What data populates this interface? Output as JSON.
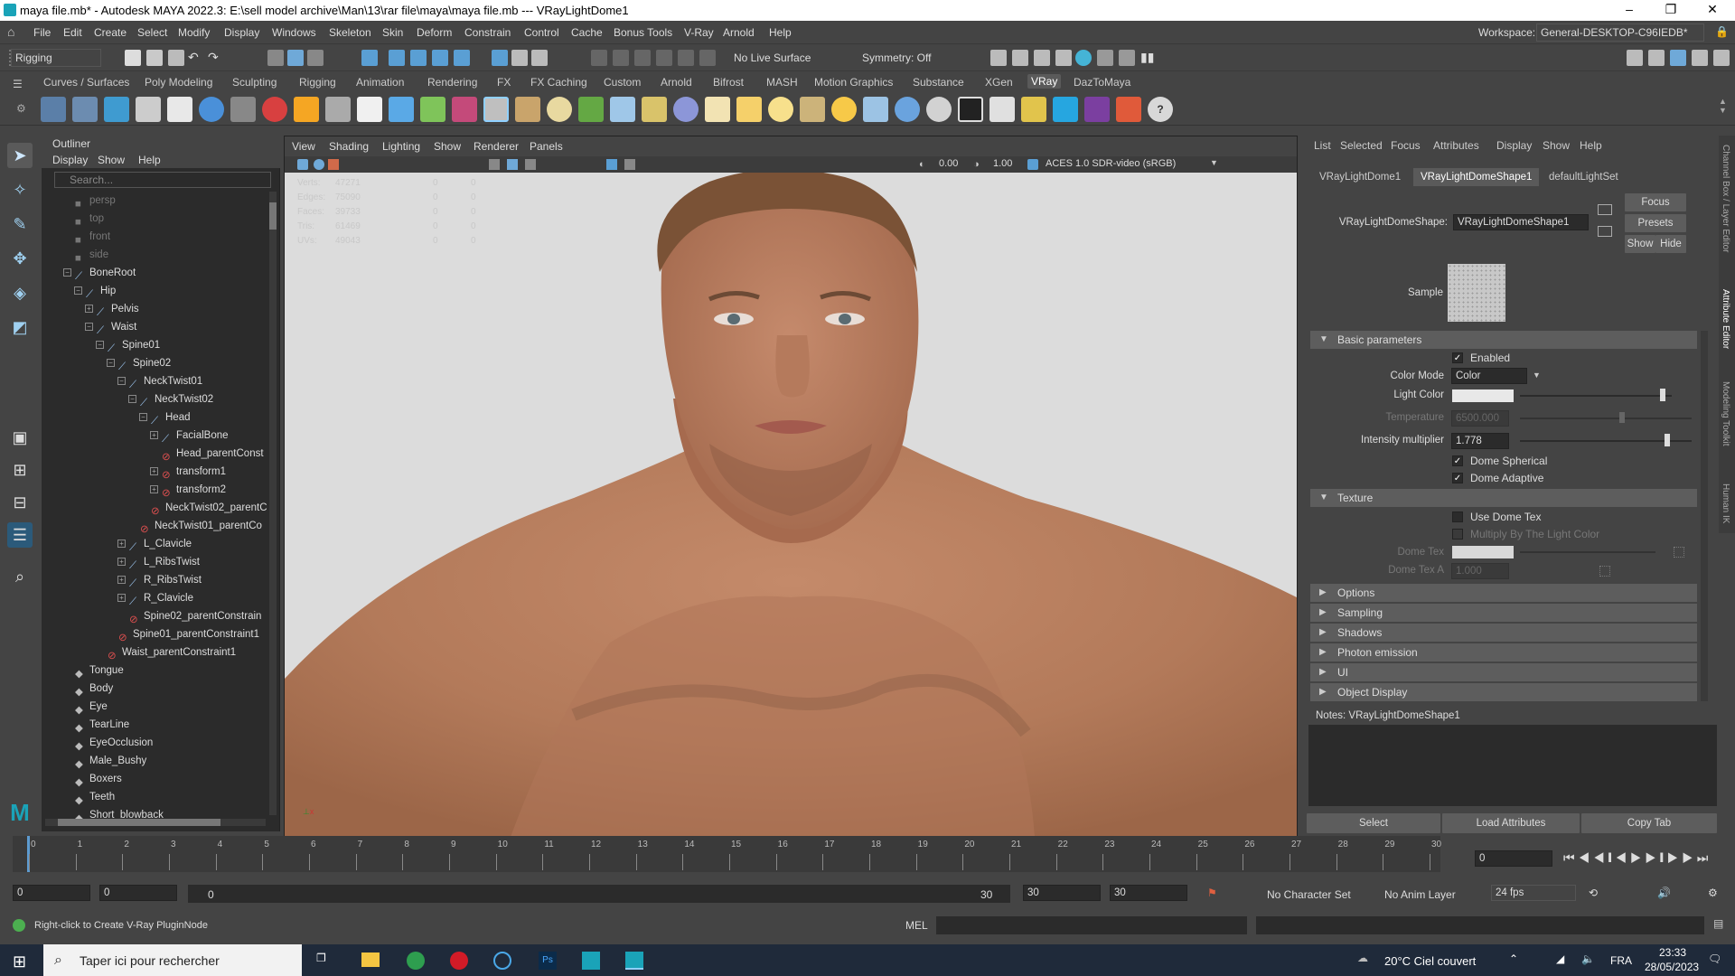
{
  "window": {
    "title": "maya file.mb* - Autodesk MAYA 2022.3: E:\\sell model archive\\Man\\13\\rar file\\maya\\maya file.mb  ---  VRayLightDome1",
    "controls": [
      "–",
      "❐",
      "✕"
    ]
  },
  "menubar": {
    "items": [
      "File",
      "Edit",
      "Create",
      "Select",
      "Modify",
      "Display",
      "Windows",
      "Skeleton",
      "Skin",
      "Deform",
      "Constrain",
      "Control",
      "Cache",
      "Bonus Tools",
      "V-Ray",
      "Arnold",
      "Help"
    ],
    "workspace_label": "Workspace:",
    "workspace_value": "General-DESKTOP-C96IEDB*"
  },
  "statusline": {
    "mode": "Rigging",
    "live_surface": "No Live Surface",
    "symmetry": "Symmetry: Off"
  },
  "shelf": {
    "tabs": [
      "Curves / Surfaces",
      "Poly Modeling",
      "Sculpting",
      "Rigging",
      "Animation",
      "Rendering",
      "FX",
      "FX Caching",
      "Custom",
      "Arnold",
      "Bifrost",
      "MASH",
      "Motion Graphics",
      "Substance",
      "XGen",
      "VRay",
      "DazToMaya"
    ],
    "active_tab": "VRay"
  },
  "outliner": {
    "title": "Outliner",
    "menu": [
      "Display",
      "Show",
      "Help"
    ],
    "search_placeholder": "Search...",
    "rows": [
      {
        "label": "persp",
        "indent": 0,
        "kind": "cam",
        "dim": true
      },
      {
        "label": "top",
        "indent": 0,
        "kind": "cam",
        "dim": true
      },
      {
        "label": "front",
        "indent": 0,
        "kind": "cam",
        "dim": true
      },
      {
        "label": "side",
        "indent": 0,
        "kind": "cam",
        "dim": true
      },
      {
        "label": "BoneRoot",
        "indent": 0,
        "kind": "bone",
        "exp": "−"
      },
      {
        "label": "Hip",
        "indent": 1,
        "kind": "bone",
        "exp": "−"
      },
      {
        "label": "Pelvis",
        "indent": 2,
        "kind": "bone",
        "exp": "+"
      },
      {
        "label": "Waist",
        "indent": 2,
        "kind": "bone",
        "exp": "−"
      },
      {
        "label": "Spine01",
        "indent": 3,
        "kind": "bone",
        "exp": "−"
      },
      {
        "label": "Spine02",
        "indent": 4,
        "kind": "bone",
        "exp": "−"
      },
      {
        "label": "NeckTwist01",
        "indent": 5,
        "kind": "bone",
        "exp": "−"
      },
      {
        "label": "NeckTwist02",
        "indent": 6,
        "kind": "bone",
        "exp": "−"
      },
      {
        "label": "Head",
        "indent": 7,
        "kind": "bone",
        "exp": "−"
      },
      {
        "label": "FacialBone",
        "indent": 8,
        "kind": "bone",
        "exp": "+"
      },
      {
        "label": "Head_parentConst",
        "indent": 8,
        "kind": "con"
      },
      {
        "label": "transform1",
        "indent": 8,
        "kind": "con",
        "exp": "+"
      },
      {
        "label": "transform2",
        "indent": 8,
        "kind": "con",
        "exp": "+"
      },
      {
        "label": "NeckTwist02_parentC",
        "indent": 7,
        "kind": "con"
      },
      {
        "label": "NeckTwist01_parentCo",
        "indent": 6,
        "kind": "con"
      },
      {
        "label": "L_Clavicle",
        "indent": 5,
        "kind": "bone",
        "exp": "+"
      },
      {
        "label": "L_RibsTwist",
        "indent": 5,
        "kind": "bone",
        "exp": "+"
      },
      {
        "label": "R_RibsTwist",
        "indent": 5,
        "kind": "bone",
        "exp": "+"
      },
      {
        "label": "R_Clavicle",
        "indent": 5,
        "kind": "bone",
        "exp": "+"
      },
      {
        "label": "Spine02_parentConstrain",
        "indent": 5,
        "kind": "con"
      },
      {
        "label": "Spine01_parentConstraint1",
        "indent": 4,
        "kind": "con"
      },
      {
        "label": "Waist_parentConstraint1",
        "indent": 3,
        "kind": "con"
      },
      {
        "label": "Tongue",
        "indent": 0,
        "kind": "mesh"
      },
      {
        "label": "Body",
        "indent": 0,
        "kind": "mesh"
      },
      {
        "label": "Eye",
        "indent": 0,
        "kind": "mesh"
      },
      {
        "label": "TearLine",
        "indent": 0,
        "kind": "mesh"
      },
      {
        "label": "EyeOcclusion",
        "indent": 0,
        "kind": "mesh"
      },
      {
        "label": "Male_Bushy",
        "indent": 0,
        "kind": "mesh"
      },
      {
        "label": "Boxers",
        "indent": 0,
        "kind": "mesh"
      },
      {
        "label": "Teeth",
        "indent": 0,
        "kind": "mesh"
      },
      {
        "label": "Short_blowback",
        "indent": 0,
        "kind": "mesh"
      }
    ]
  },
  "viewport": {
    "menu": [
      "View",
      "Shading",
      "Lighting",
      "Show",
      "Renderer",
      "Panels"
    ],
    "exposure": "0.00",
    "gamma": "1.00",
    "colorspace": "ACES 1.0 SDR-video (sRGB)",
    "stats": [
      {
        "name": "Verts:",
        "a": "47271",
        "b": "0",
        "c": "0"
      },
      {
        "name": "Edges:",
        "a": "75090",
        "b": "0",
        "c": "0"
      },
      {
        "name": "Faces:",
        "a": "39733",
        "b": "0",
        "c": "0"
      },
      {
        "name": "Tris:",
        "a": "61469",
        "b": "0",
        "c": "0"
      },
      {
        "name": "UVs:",
        "a": "49043",
        "b": "0",
        "c": "0"
      }
    ]
  },
  "attribute_editor": {
    "menu": [
      "List",
      "Selected",
      "Focus",
      "Attributes",
      "Display",
      "Show",
      "Help"
    ],
    "tabs": [
      "VRayLightDome1",
      "VRayLightDomeShape1",
      "defaultLightSet"
    ],
    "active_tab": "VRayLightDomeShape1",
    "shape_label": "VRayLightDomeShape:",
    "shape_value": "VRayLightDomeShape1",
    "focus_btn": "Focus",
    "presets_btn": "Presets",
    "show_btn": "Show",
    "hide_btn": "Hide",
    "sample_label": "Sample",
    "basic_section": "Basic parameters",
    "enabled_label": "Enabled",
    "color_mode_label": "Color Mode",
    "color_mode_value": "Color",
    "light_color_label": "Light Color",
    "temperature_label": "Temperature",
    "temperature_value": "6500.000",
    "intensity_label": "Intensity multiplier",
    "intensity_value": "1.778",
    "dome_spherical_label": "Dome Spherical",
    "dome_adaptive_label": "Dome Adaptive",
    "texture_section": "Texture",
    "use_dome_tex_label": "Use Dome Tex",
    "multiply_label": "Multiply By The Light Color",
    "dome_tex_label": "Dome Tex",
    "dome_tex_a_label": "Dome Tex A",
    "dome_tex_a_value": "1.000",
    "collapsed_sections": [
      "Options",
      "Sampling",
      "Shadows",
      "Photon emission",
      "UI",
      "Object Display"
    ],
    "notes_label": "Notes:  VRayLightDomeShape1",
    "select_btn": "Select",
    "load_btn": "Load Attributes",
    "copy_btn": "Copy Tab",
    "side_tabs": [
      "Channel Box / Layer Editor",
      "Attribute Editor",
      "Modeling Toolkit",
      "Human IK"
    ]
  },
  "timeline": {
    "ticks": [
      "0",
      "1",
      "2",
      "3",
      "4",
      "5",
      "6",
      "7",
      "8",
      "9",
      "10",
      "11",
      "12",
      "13",
      "14",
      "15",
      "16",
      "17",
      "18",
      "19",
      "20",
      "21",
      "22",
      "23",
      "24",
      "25",
      "26",
      "27",
      "28",
      "29",
      "30"
    ],
    "current_frame": "0"
  },
  "range": {
    "start": "0",
    "start2": "0",
    "slider_start": "0",
    "slider_end": "30",
    "end": "30",
    "end2": "30",
    "character_set": "No Character Set",
    "anim_layer": "No Anim Layer",
    "fps": "24 fps"
  },
  "cmdline": {
    "help": "Right-click to Create V-Ray PluginNode",
    "lang": "MEL"
  },
  "taskbar": {
    "search_placeholder": "Taper ici pour rechercher",
    "weather": "20°C  Ciel couvert",
    "lang": "FRA",
    "time": "23:33",
    "date": "28/05/2023"
  }
}
